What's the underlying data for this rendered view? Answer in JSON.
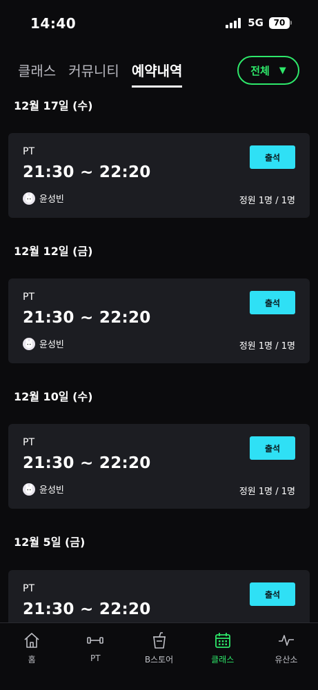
{
  "status_bar": {
    "time": "14:40",
    "network": "5G",
    "battery": "70"
  },
  "tabs": [
    {
      "label": "클래스",
      "active": false
    },
    {
      "label": "커뮤니티",
      "active": false
    },
    {
      "label": "예약내역",
      "active": true
    }
  ],
  "filter": {
    "label": "전체",
    "caret_icon": "triangle-down-icon",
    "color": "#2ee86a"
  },
  "reservations": [
    {
      "date": "12월 17일 (수)",
      "type": "PT",
      "time": "21:30 ~ 22:20",
      "trainer": "윤성빈",
      "capacity": "정원 1명 / 1명",
      "action": "출석"
    },
    {
      "date": "12월 12일 (금)",
      "type": "PT",
      "time": "21:30 ~ 22:20",
      "trainer": "윤성빈",
      "capacity": "정원 1명 / 1명",
      "action": "출석"
    },
    {
      "date": "12월 10일 (수)",
      "type": "PT",
      "time": "21:30 ~ 22:20",
      "trainer": "윤성빈",
      "capacity": "정원 1명 / 1명",
      "action": "출석"
    },
    {
      "date": "12월 5일 (금)",
      "type": "PT",
      "time": "21:30 ~ 22:20",
      "trainer": "",
      "capacity": "",
      "action": "출석"
    }
  ],
  "bottom_nav": [
    {
      "label": "홈",
      "icon": "home-icon",
      "active": false
    },
    {
      "label": "PT",
      "icon": "dumbbell-icon",
      "active": false
    },
    {
      "label": "B스토어",
      "icon": "cup-icon",
      "active": false
    },
    {
      "label": "클래스",
      "icon": "calendar-icon",
      "active": true
    },
    {
      "label": "유산소",
      "icon": "pulse-icon",
      "active": false
    }
  ],
  "colors": {
    "accent_green": "#2ee86a",
    "checkin_cyan": "#2fe0f5",
    "card_bg": "#1c1d22",
    "page_bg": "#0b0b0d"
  }
}
